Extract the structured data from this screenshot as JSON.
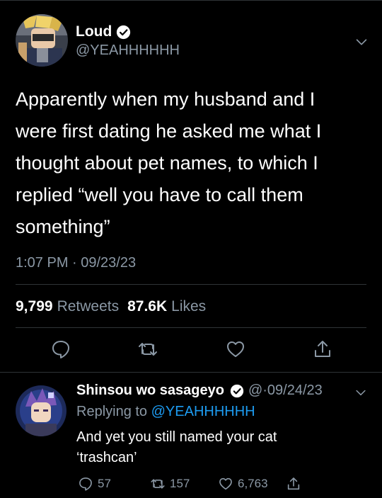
{
  "tweet": {
    "display_name": "Loud",
    "handle": "@YEAHHHHHH",
    "text": "Apparently when my husband and I\nwere first dating he asked me what I\nthought about pet names, to which I\nreplied “well you have to call them\nsomething”",
    "timestamp": "1:07 PM · 09/23/23",
    "retweets_count": "9,799",
    "retweets_label": "Retweets",
    "likes_count": "87.6K",
    "likes_label": "Likes"
  },
  "reply": {
    "display_name": "Shinsou wo sasageyo",
    "handle_date": "@·09/24/23",
    "replying_prefix": "Replying to ",
    "replying_to": "@YEAHHHHHH",
    "text": "And yet you still named your cat\n‘trashcan’",
    "reply_count": "57",
    "retweet_count": "157",
    "like_count": "6,763"
  },
  "colors": {
    "background": "#000000",
    "text_primary": "#ffffff",
    "text_secondary": "#8b98a5",
    "accent": "#1d9bf0",
    "divider": "#2f3336"
  },
  "icons": {
    "verified": "verified-badge-icon",
    "menu": "chevron-down-icon",
    "reply": "reply-bubble-icon",
    "retweet": "retweet-icon",
    "like": "heart-icon",
    "share": "share-icon"
  }
}
